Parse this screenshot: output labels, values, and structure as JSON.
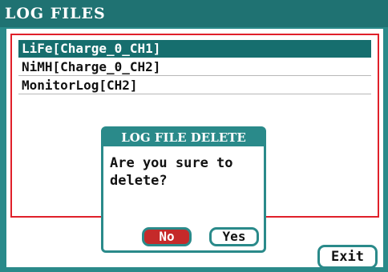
{
  "window": {
    "title": "LOG FILES"
  },
  "files": {
    "items": [
      {
        "label": "LiFe[Charge_0_CH1]",
        "selected": true
      },
      {
        "label": "NiMH[Charge_0_CH2]",
        "selected": false
      },
      {
        "label": "MonitorLog[CH2]",
        "selected": false
      }
    ]
  },
  "dialog": {
    "title": "LOG FILE DELETE",
    "message": "Are you sure to\ndelete?",
    "no_label": "No",
    "yes_label": "Yes"
  },
  "footer": {
    "exit_label": "Exit"
  },
  "colors": {
    "accent": "#2a8a8a",
    "selected": "#166e6e",
    "alert": "#e0202a",
    "no_button": "#c52a2a"
  }
}
